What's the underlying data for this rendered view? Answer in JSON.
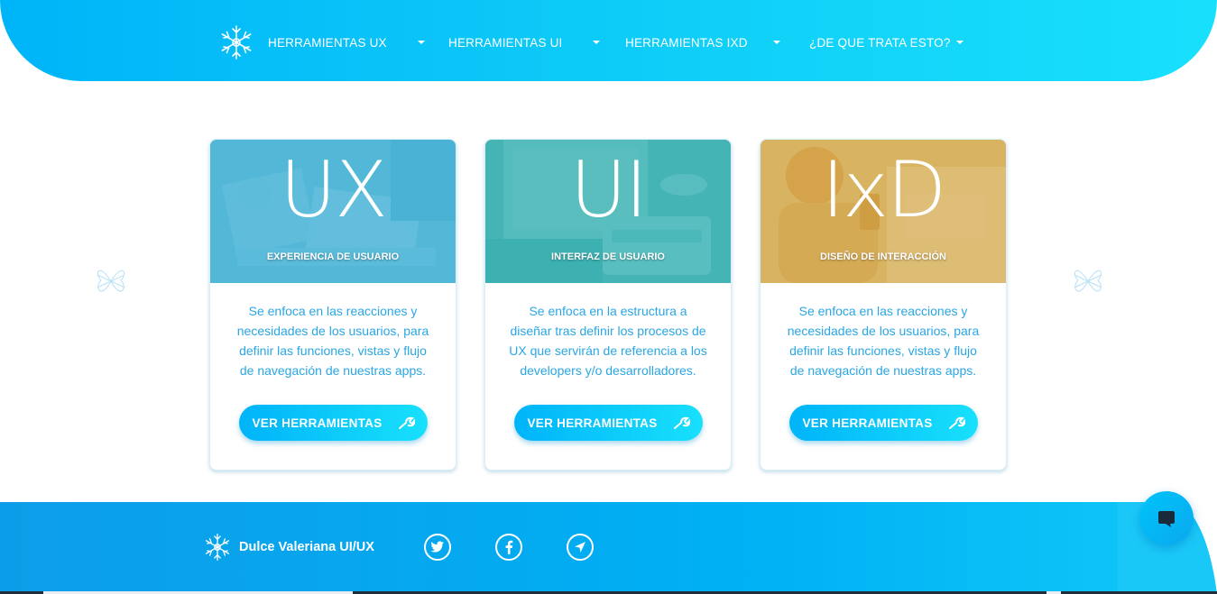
{
  "nav": {
    "items": [
      {
        "label": "HERRAMIENTAS UX"
      },
      {
        "label": "HERRAMIENTAS UI"
      },
      {
        "label": "HERRAMIENTAS IXD"
      },
      {
        "label": "¿DE QUE TRATA ESTO?"
      }
    ]
  },
  "cards": [
    {
      "title": "UX",
      "subtitle": "EXPERIENCIA DE USUARIO",
      "description": "Se enfoca en las reacciones y necesidades de los usuarios, para definir las funciones, vistas y flujo de navegación de nuestras apps.",
      "button": "VER HERRAMIENTAS",
      "overlay_color": "#2aa6cf"
    },
    {
      "title": "UI",
      "subtitle": "INTERFAZ DE USUARIO",
      "description": "Se enfoca en la estructura a diseñar tras definir los procesos de UX que servirán de referencia a los developers y/o desarrolladores.",
      "button": "VER HERRAMIENTAS",
      "overlay_color": "#1fa6a8"
    },
    {
      "title": "IxD",
      "subtitle": "DISEÑO DE INTERACCIÓN",
      "description": "Se enfoca en las reacciones y necesidades de los usuarios, para definir las funciones, vistas y flujo de navegación de nuestras apps.",
      "button": "VER HERRAMIENTAS",
      "overlay_color": "#c99b35"
    }
  ],
  "footer": {
    "brand": "Dulce Valeriana UI/UX",
    "social": [
      "twitter-icon",
      "facebook-icon",
      "location-arrow-icon"
    ]
  },
  "colors": {
    "accent_start": "#00b4f8",
    "accent_end": "#18e0fc",
    "text_blue": "#2aa6e3"
  }
}
